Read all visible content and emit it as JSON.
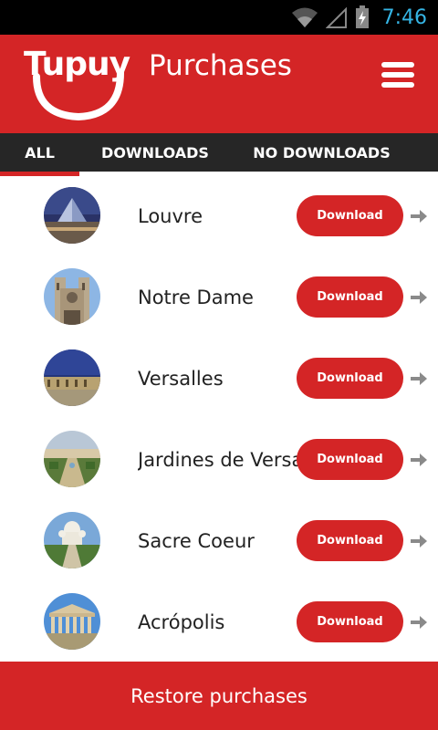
{
  "status_bar": {
    "time": "7:46",
    "icons": [
      "wifi-icon",
      "signal-icon",
      "battery-charging-icon"
    ]
  },
  "header": {
    "logo_text": "Tupuy",
    "title": "Purchases",
    "menu_icon": "hamburger-menu-icon"
  },
  "tabs": [
    {
      "label": "ALL",
      "active": true
    },
    {
      "label": "DOWNLOADS",
      "active": false
    },
    {
      "label": "NO DOWNLOADS",
      "active": false
    }
  ],
  "items": [
    {
      "name": "Louvre",
      "button": "Download"
    },
    {
      "name": "Notre Dame",
      "button": "Download"
    },
    {
      "name": "Versalles",
      "button": "Download"
    },
    {
      "name": "Jardines de Versalles",
      "button": "Download"
    },
    {
      "name": "Sacre Coeur",
      "button": "Download"
    },
    {
      "name": "Acrópolis",
      "button": "Download"
    }
  ],
  "footer": {
    "label": "Restore purchases"
  },
  "colors": {
    "brand_red": "#d42526",
    "tab_bar": "#262626",
    "status_accent": "#35b5e5",
    "arrow_gray": "#8a8a8a"
  }
}
